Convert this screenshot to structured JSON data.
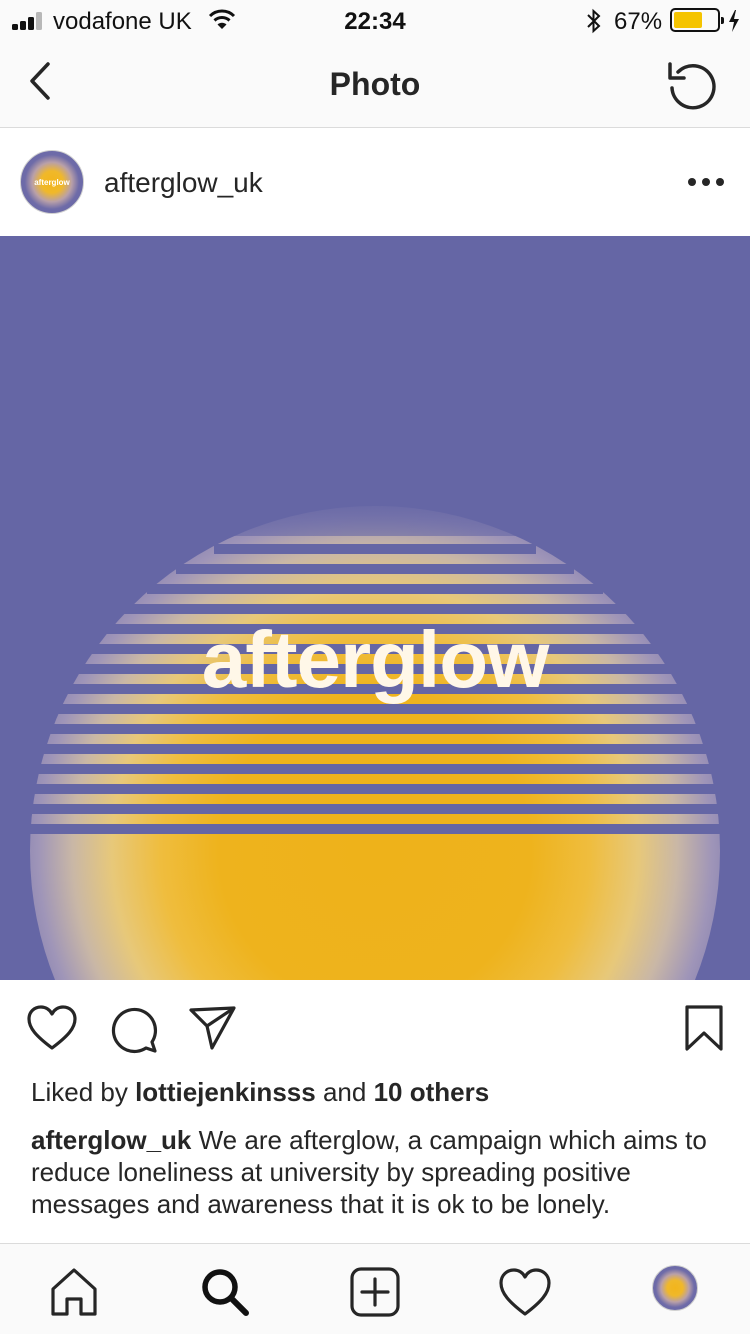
{
  "status_bar": {
    "carrier": "vodafone UK",
    "time": "22:34",
    "battery_percent": "67%",
    "battery_level": 0.67,
    "signal_bars": 3,
    "icons": [
      "signal-icon",
      "wifi-icon",
      "bluetooth-icon",
      "battery-icon",
      "charging-icon"
    ]
  },
  "nav": {
    "title": "Photo",
    "back_icon": "chevron-left-icon",
    "refresh_icon": "refresh-icon"
  },
  "post": {
    "username": "afterglow_uk",
    "avatar_text": "afterglow",
    "more_icon": "more-options-icon",
    "image_text": "afterglow",
    "image_colors": {
      "background": "#6566a5",
      "sun": "#eeb21a",
      "text": "#fff7e8"
    }
  },
  "actions": {
    "icons": [
      "heart-icon",
      "comment-icon",
      "share-icon",
      "bookmark-icon"
    ]
  },
  "likes": {
    "prefix": "Liked by",
    "user": "lottiejenkinsss",
    "middle": "and",
    "others": "10 others"
  },
  "caption": {
    "username": "afterglow_uk",
    "text": "We are afterglow, a campaign which aims to reduce loneliness at university by spreading positive messages and awareness that it is ok to be lonely."
  },
  "tab_bar": {
    "items": [
      "home-icon",
      "search-icon",
      "new-post-icon",
      "activity-icon",
      "profile-avatar"
    ]
  }
}
